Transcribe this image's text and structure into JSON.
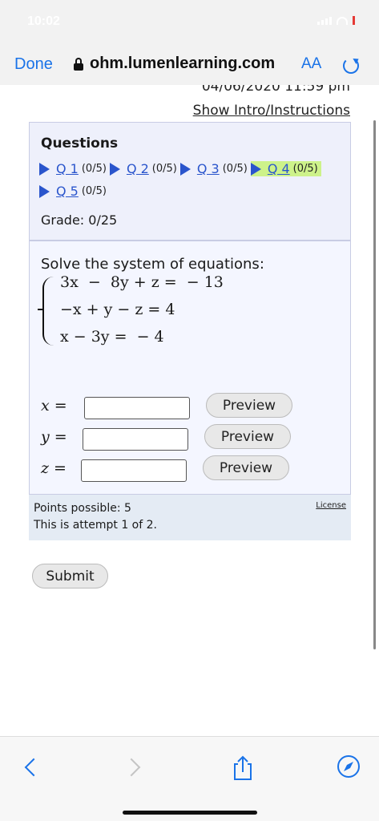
{
  "status_bar": {
    "time": "10:02"
  },
  "nav": {
    "done_label": "Done",
    "url": "ohm.lumenlearning.com",
    "aa_label": "AA"
  },
  "header": {
    "date_text": "04/06/2020 11:59 pm",
    "intro_link": "Show Intro/Instructions"
  },
  "questions": {
    "title": "Questions",
    "items": [
      {
        "label": "Q 1",
        "score": "(0/5)",
        "current": false
      },
      {
        "label": "Q 2",
        "score": "(0/5)",
        "current": false
      },
      {
        "label": "Q 3",
        "score": "(0/5)",
        "current": false
      },
      {
        "label": "Q 4",
        "score": "(0/5)",
        "current": true
      },
      {
        "label": "Q 5",
        "score": "(0/5)",
        "current": false
      }
    ],
    "grade": "Grade: 0/25"
  },
  "problem": {
    "prompt": "Solve the system of equations:",
    "equations": [
      "3x  −  8y + z =  − 13",
      "−x + y − z = 4",
      "x − 3y =  − 4"
    ],
    "variables": [
      {
        "label": "x =",
        "value": "",
        "preview": "Preview"
      },
      {
        "label": "y =",
        "value": "",
        "preview": "Preview"
      },
      {
        "label": "z =",
        "value": "",
        "preview": "Preview"
      }
    ],
    "points": "Points possible: 5",
    "attempt": "This is attempt 1 of 2.",
    "license": "License"
  },
  "submit_label": "Submit",
  "colors": {
    "link": "#2a55cc",
    "current_highlight": "#cdf28a",
    "ios_blue": "#1a73e8"
  }
}
